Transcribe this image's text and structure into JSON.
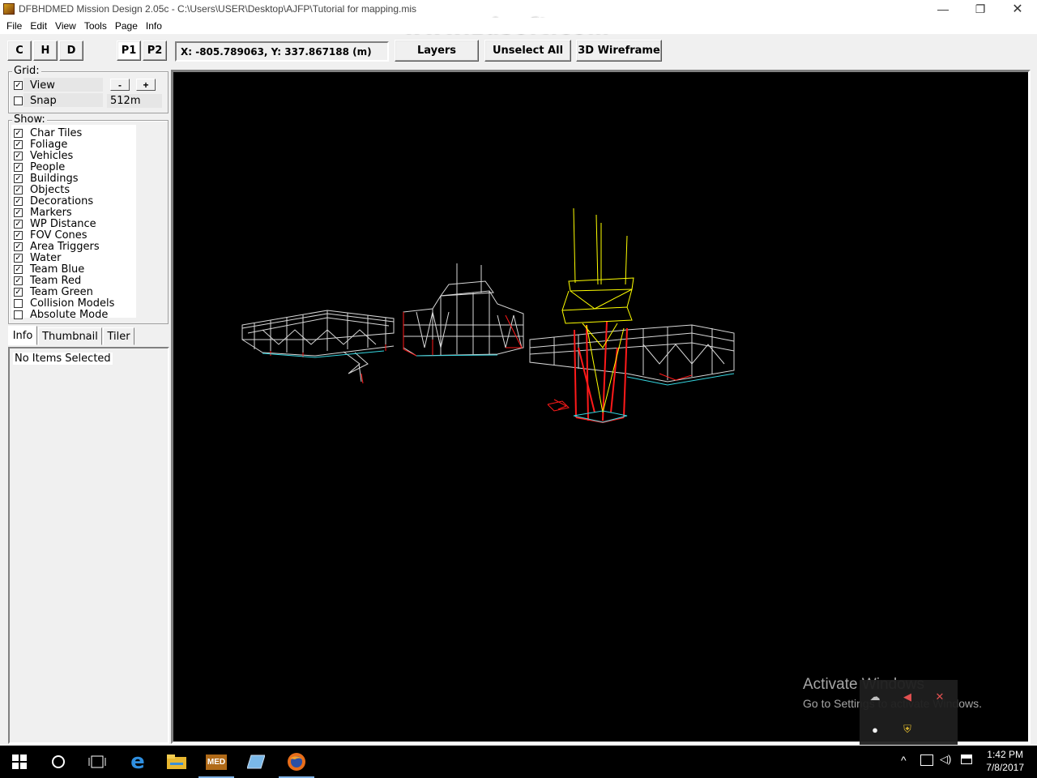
{
  "window": {
    "title": "DFBHDMED Mission Design 2.05c - C:\\Users\\USER\\Desktop\\AJFP\\Tutorial for mapping.mis",
    "watermark": "www.zdsoft.com",
    "minimize": "—",
    "maximize": "❐",
    "close": "✕"
  },
  "menu": [
    "File",
    "Edit",
    "View",
    "Tools",
    "Page",
    "Info"
  ],
  "toolbar": {
    "btn_c": "C",
    "btn_h": "H",
    "btn_d": "D",
    "btn_p1": "P1",
    "btn_p2": "P2",
    "coordinates": "X: -805.789063, Y: 337.867188 (m)",
    "layers": "Layers",
    "unselect_all": "Unselect All",
    "wireframe": "3D Wireframe"
  },
  "grid": {
    "label": "Grid:",
    "view_label": "View",
    "view_checked": true,
    "snap_label": "Snap",
    "snap_checked": false,
    "minus": "-",
    "plus": "+",
    "size": "512m"
  },
  "show": {
    "label": "Show:",
    "items": [
      {
        "label": "Char Tiles",
        "checked": true
      },
      {
        "label": "Foliage",
        "checked": true
      },
      {
        "label": "Vehicles",
        "checked": true
      },
      {
        "label": "People",
        "checked": true
      },
      {
        "label": "Buildings",
        "checked": true
      },
      {
        "label": "Objects",
        "checked": true
      },
      {
        "label": "Decorations",
        "checked": true
      },
      {
        "label": "Markers",
        "checked": true
      },
      {
        "label": "WP Distance",
        "checked": true
      },
      {
        "label": "FOV Cones",
        "checked": true
      },
      {
        "label": "Area Triggers",
        "checked": true
      },
      {
        "label": "Water",
        "checked": true
      },
      {
        "label": "Team Blue",
        "checked": true
      },
      {
        "label": "Team Red",
        "checked": true
      },
      {
        "label": "Team Green",
        "checked": true
      },
      {
        "label": "Collision Models",
        "checked": false
      },
      {
        "label": "Absolute Mode",
        "checked": false
      }
    ]
  },
  "tabs": {
    "info": "Info",
    "thumbnail": "Thumbnail",
    "tiler": "Tiler"
  },
  "info_panel": {
    "status": "No Items Selected"
  },
  "activation": {
    "title": "Activate Windows",
    "subtitle": "Go to Settings to activate Windows."
  },
  "taskbar": {
    "time": "1:42 PM",
    "date": "7/8/2017",
    "med_label": "MED"
  },
  "colors": {
    "viewport_bg": "#000000",
    "wire_white": "#d8d8d8",
    "wire_red": "#ff1a1a",
    "wire_yellow": "#ffff00",
    "wire_cyan": "#35d6e0"
  }
}
